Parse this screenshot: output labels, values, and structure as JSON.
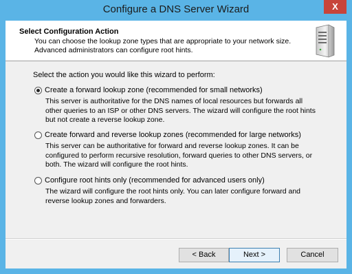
{
  "window": {
    "title": "Configure a DNS Server Wizard",
    "close_glyph": "X"
  },
  "header": {
    "title": "Select Configuration Action",
    "description": "You can choose the lookup zone types that are appropriate to your network size. Advanced administrators can configure root hints.",
    "icon": "server-icon"
  },
  "prompt": "Select the action you would like this wizard to perform:",
  "options": [
    {
      "label": "Create a forward lookup zone (recommended for small networks)",
      "description": "This server is authoritative for the DNS names of local resources but forwards all other queries to an ISP or other DNS servers. The wizard will configure the root hints but not create a reverse lookup zone.",
      "selected": true
    },
    {
      "label": "Create forward and reverse lookup zones (recommended for large networks)",
      "description": "This server can be authoritative for forward and reverse lookup zones. It can be configured to perform recursive resolution, forward queries to other DNS servers, or both. The wizard will configure the root hints.",
      "selected": false
    },
    {
      "label": "Configure root hints only (recommended for advanced users only)",
      "description": "The wizard will configure the root hints only. You can later configure forward and reverse lookup zones and forwarders.",
      "selected": false
    }
  ],
  "buttons": {
    "back": "< Back",
    "next": "Next >",
    "cancel": "Cancel"
  },
  "colors": {
    "titlebar": "#5ab4e6",
    "close": "#c7443a",
    "dialog": "#f0f0f0"
  }
}
